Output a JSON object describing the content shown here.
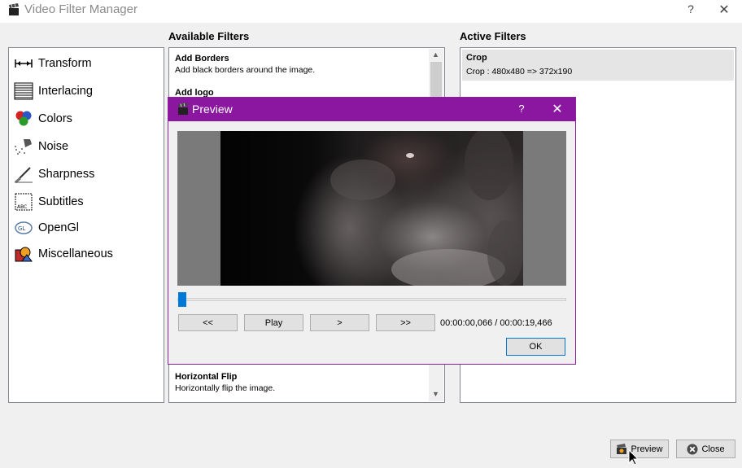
{
  "window": {
    "title": "Video Filter Manager",
    "help": "?",
    "close": "✕"
  },
  "available_filters": {
    "title": "Available Filters",
    "items": [
      {
        "name": "Add Borders",
        "desc": "Add black borders around the image."
      },
      {
        "name": "Add logo",
        "desc": ""
      },
      {
        "name": "Horizontal Flip",
        "desc": "Horizontally flip the image."
      }
    ]
  },
  "active_filters": {
    "title": "Active Filters",
    "items": [
      {
        "name": "Crop",
        "desc": "Crop : 480x480 => 372x190"
      }
    ]
  },
  "categories": [
    {
      "label": "Transform",
      "icon": "transform-icon"
    },
    {
      "label": "Interlacing",
      "icon": "interlacing-icon"
    },
    {
      "label": "Colors",
      "icon": "colors-icon"
    },
    {
      "label": "Noise",
      "icon": "noise-icon"
    },
    {
      "label": "Sharpness",
      "icon": "sharpness-icon"
    },
    {
      "label": "Subtitles",
      "icon": "subtitles-icon"
    },
    {
      "label": "OpenGl",
      "icon": "opengl-icon"
    },
    {
      "label": "Miscellaneous",
      "icon": "miscellaneous-icon"
    }
  ],
  "buttons": {
    "preview": "Preview",
    "close": "Close"
  },
  "preview": {
    "title": "Preview",
    "help": "?",
    "close": "✕",
    "rewind": "<<",
    "play": "Play",
    "next": ">",
    "fast_forward": ">>",
    "time": "00:00:00,066 / 00:00:19,466",
    "ok": "OK",
    "position_fraction": 0.0
  },
  "colors": {
    "dialog_titlebar": "#8b17a0",
    "slider_accent": "#0078d7"
  }
}
